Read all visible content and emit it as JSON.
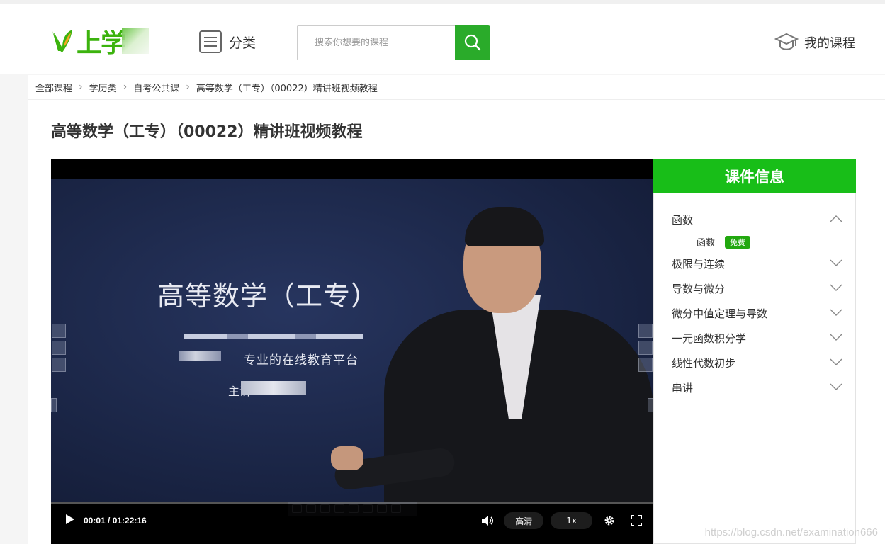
{
  "header": {
    "logo_text": "上学",
    "category_label": "分类",
    "search_placeholder": "搜索你想要的课程",
    "my_courses_label": "我的课程"
  },
  "breadcrumb": [
    "全部课程",
    "学历类",
    "自考公共课",
    "高等数学（工专）（00022）精讲班视频教程"
  ],
  "page_title": "高等数学（工专）（00022）精讲班视频教程",
  "video": {
    "slide_title": "高等数学（工专）",
    "slide_subtitle": "专业的在线教育平台",
    "slide_host": "主讲",
    "time": "00:01 / 01:22:16",
    "quality": "高清",
    "speed": "1x",
    "progress_fraction": 0.0002
  },
  "course_info": {
    "title": "课件信息",
    "chapters": [
      {
        "label": "函数",
        "expanded": true,
        "lessons": [
          {
            "label": "函数",
            "badge": "免费"
          }
        ]
      },
      {
        "label": "极限与连续",
        "expanded": false
      },
      {
        "label": "导数与微分",
        "expanded": false
      },
      {
        "label": "微分中值定理与导数",
        "expanded": false
      },
      {
        "label": "一元函数积分学",
        "expanded": false
      },
      {
        "label": "线性代数初步",
        "expanded": false
      },
      {
        "label": "串讲",
        "expanded": false
      }
    ]
  },
  "watermark": "https://blog.csdn.net/examination666",
  "colors": {
    "brand_green": "#18be18",
    "search_button": "#2aab2a",
    "badge": "#22a80f"
  }
}
